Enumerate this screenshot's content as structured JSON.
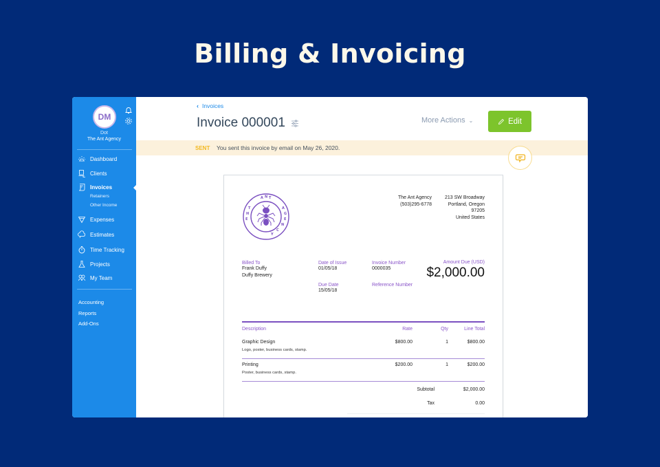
{
  "page": {
    "headline": "Billing & Invoicing"
  },
  "sidebar": {
    "avatar_initials": "DM",
    "user_name": "Dot",
    "org_name": "The Ant Agency",
    "nav": [
      {
        "label": "Dashboard",
        "icon": "dashboard-icon"
      },
      {
        "label": "Clients",
        "icon": "clients-icon"
      },
      {
        "label": "Invoices",
        "icon": "invoices-icon",
        "active": true
      },
      {
        "label": "Expenses",
        "icon": "expenses-icon"
      },
      {
        "label": "Estimates",
        "icon": "estimates-icon"
      },
      {
        "label": "Time Tracking",
        "icon": "time-tracking-icon"
      },
      {
        "label": "Projects",
        "icon": "projects-icon"
      },
      {
        "label": "My Team",
        "icon": "my-team-icon"
      }
    ],
    "sub_items": [
      "Retainers",
      "Other Income"
    ],
    "extra": [
      "Accounting",
      "Reports",
      "Add-Ons"
    ]
  },
  "header": {
    "breadcrumb": "Invoices",
    "title": "Invoice 000001",
    "more_actions": "More Actions",
    "edit_label": "Edit",
    "edit_color": "#7dc42c"
  },
  "status": {
    "badge": "SENT",
    "message": "You sent this invoice by email on May 26, 2020."
  },
  "invoice": {
    "company": {
      "name": "The Ant Agency",
      "phone": "(503)295-6778"
    },
    "address": [
      "213 SW Broadway",
      "Portland, Oregon",
      "97205",
      "United States"
    ],
    "logo_text": "THE ANT AGENCY",
    "billed_to": {
      "label": "Billed To",
      "name": "Frank Duffy",
      "company": "Duffy Brewery"
    },
    "date_of_issue": {
      "label": "Date of Issue",
      "value": "01/05/18"
    },
    "due_date": {
      "label": "Due Date",
      "value": "15/05/18"
    },
    "invoice_number": {
      "label": "Invoice Number",
      "value": "0000035"
    },
    "reference_number": {
      "label": "Reference Number",
      "value": ""
    },
    "amount_due": {
      "label": "Amount Due (USD)",
      "value": "$2,000.00"
    },
    "columns": {
      "description": "Description",
      "rate": "Rate",
      "qty": "Qty",
      "line_total": "Line Total"
    },
    "items": [
      {
        "name": "Graphic Design",
        "details": "Logo, poster, business cards, stamp.",
        "rate": "$800.00",
        "qty": "1",
        "total": "$800.00"
      },
      {
        "name": "Printing",
        "details": "Poster, business cards, stamp.",
        "rate": "$200.00",
        "qty": "1",
        "total": "$200.00"
      }
    ],
    "subtotal": {
      "label": "Subtotal",
      "value": "$2,000.00"
    },
    "tax": {
      "label": "Tax",
      "value": "0.00"
    }
  }
}
